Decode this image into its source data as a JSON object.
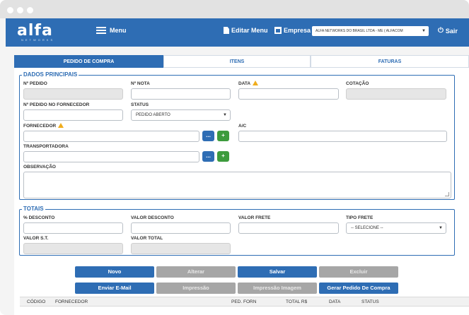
{
  "header": {
    "logo_text": "alfa",
    "logo_subtitle": "NETWORKS",
    "menu_label": "Menu",
    "edit_menu_label": "Editar Menu",
    "empresa_label": "Empresa",
    "company_selected": "ALFA NETWORKS DO BRASIL LTDA - ME ( ALFACOM",
    "logout_label": "Sair"
  },
  "tabs": [
    {
      "label": "PEDIDO DE COMPRA",
      "active": true
    },
    {
      "label": "ITENS",
      "active": false
    },
    {
      "label": "FATURAS",
      "active": false
    }
  ],
  "dados": {
    "legend": "DADOS PRINCIPAIS",
    "n_pedido_label": "Nº PEDIDO",
    "n_nota_label": "Nº NOTA",
    "data_label": "DATA",
    "cotacao_label": "COTAÇÃO",
    "n_pedido_fornecedor_label": "Nº PEDIDO NO FORNECEDOR",
    "status_label": "STATUS",
    "status_value": "PEDIDO ABERTO",
    "fornecedor_label": "FORNECEDOR",
    "ac_label": "A/C",
    "transportadora_label": "TRANSPORTADORA",
    "observacao_label": "OBSERVAÇÃO",
    "ellipsis_button": "...",
    "add_button": "+"
  },
  "totais": {
    "legend": "TOTAIS",
    "pct_desconto_label": "% DESCONTO",
    "valor_desconto_label": "VALOR DESCONTO",
    "valor_frete_label": "VALOR FRETE",
    "tipo_frete_label": "TIPO FRETE",
    "tipo_frete_value": "-- SELECIONE --",
    "valor_st_label": "VALOR S.T.",
    "valor_total_label": "VALOR TOTAL"
  },
  "actions": {
    "novo": "Novo",
    "alterar": "Alterar",
    "salvar": "Salvar",
    "excluir": "Excluir",
    "enviar_email": "Enviar E-Mail",
    "impressao": "Impressão",
    "impressao_imagem": "Impressão Imagem",
    "gerar_pedido": "Gerar Pedido De Compra"
  },
  "grid": {
    "columns": [
      "CÓDIGO",
      "FORNECEDOR",
      "PED. FORN",
      "TOTAL R$",
      "DATA",
      "STATUS"
    ]
  },
  "colors": {
    "brand": "#2e6db4",
    "warning": "#f0ad1d",
    "success": "#3d9b3d",
    "disabled": "#a6a6a6"
  }
}
